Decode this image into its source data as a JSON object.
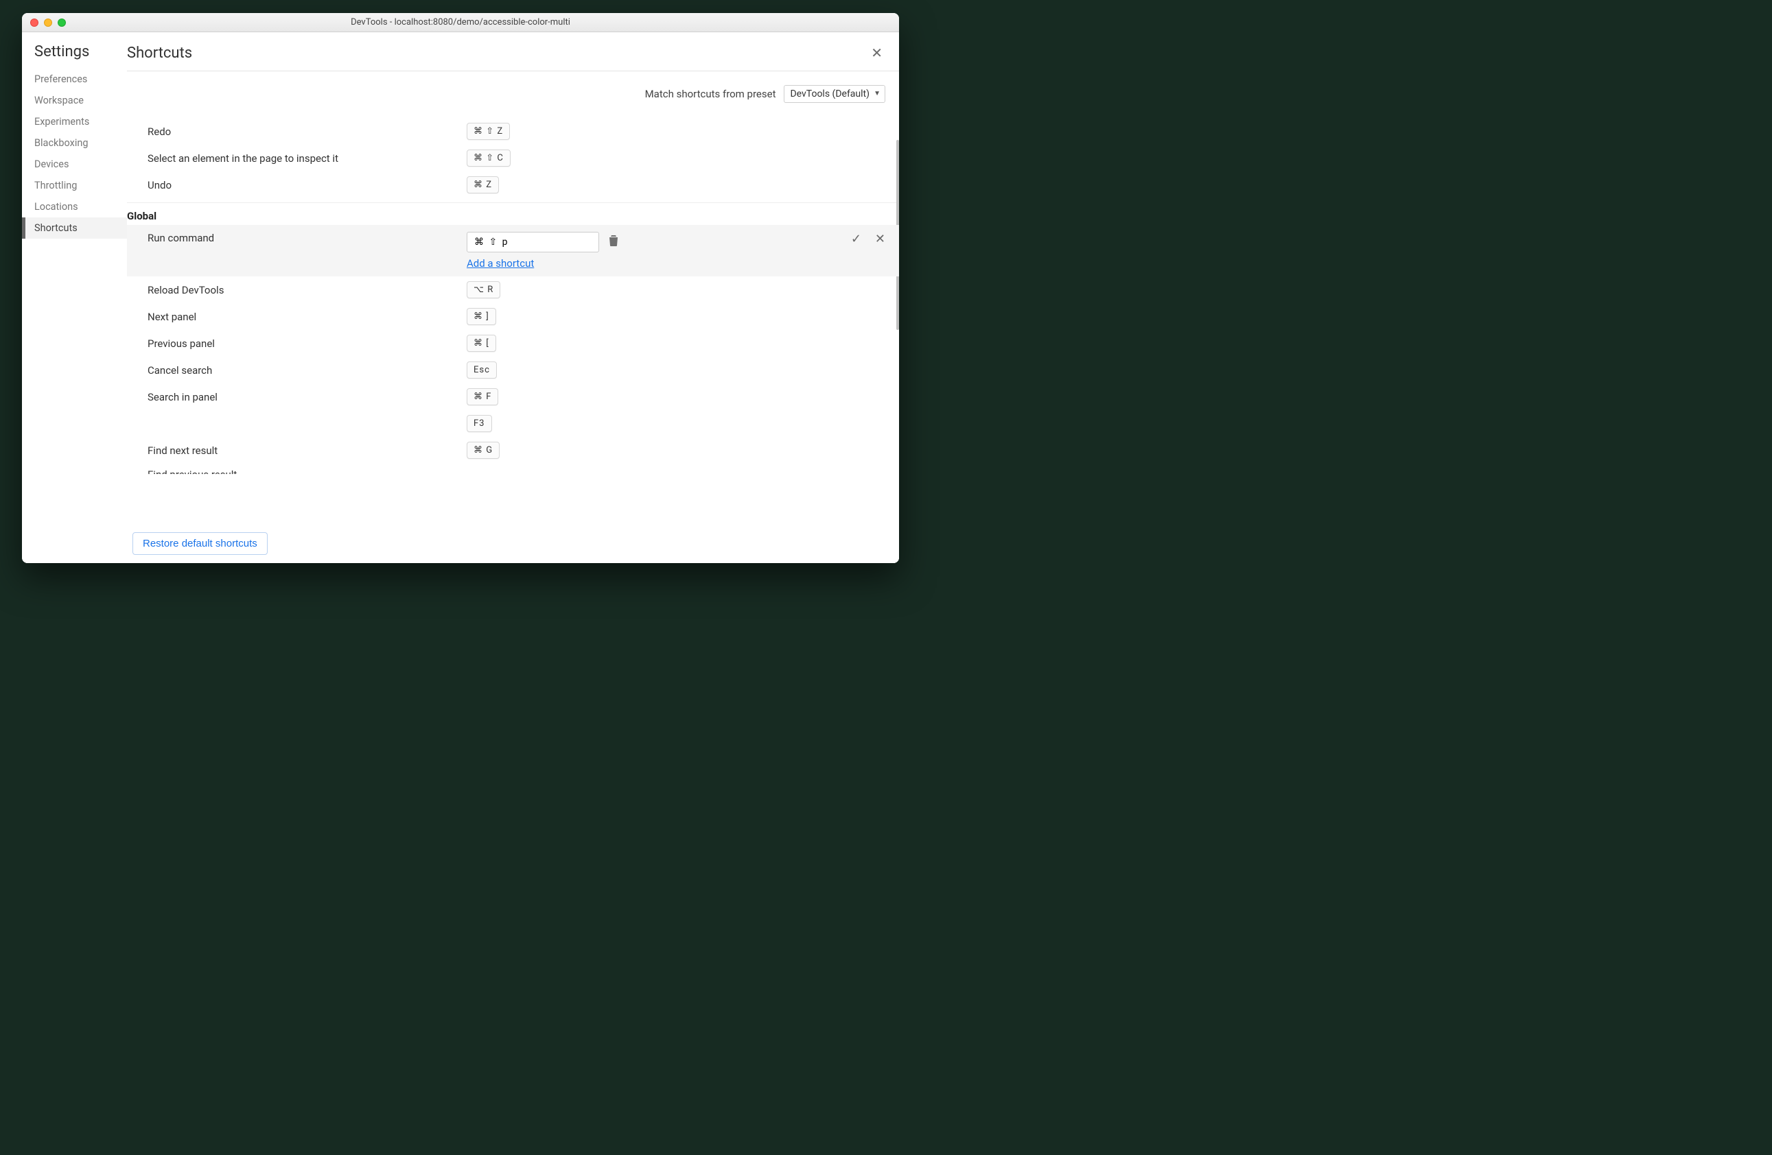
{
  "window_title": "DevTools - localhost:8080/demo/accessible-color-multi",
  "sidebar": {
    "title": "Settings",
    "items": [
      {
        "label": "Preferences"
      },
      {
        "label": "Workspace"
      },
      {
        "label": "Experiments"
      },
      {
        "label": "Blackboxing"
      },
      {
        "label": "Devices"
      },
      {
        "label": "Throttling"
      },
      {
        "label": "Locations"
      },
      {
        "label": "Shortcuts"
      }
    ]
  },
  "page": {
    "title": "Shortcuts",
    "preset_label": "Match shortcuts from preset",
    "preset_value": "DevTools (Default)",
    "restore_label": "Restore default shortcuts"
  },
  "top_rows": [
    {
      "label": "Redo",
      "combo": "⌘ ⇧ Z"
    },
    {
      "label": "Select an element in the page to inspect it",
      "combo": "⌘ ⇧ C"
    },
    {
      "label": "Undo",
      "combo": "⌘  Z"
    }
  ],
  "group": "Global",
  "editing": {
    "label": "Run command",
    "input_value": "⌘ ⇧ p",
    "add_link": "Add a shortcut"
  },
  "bottom_rows": [
    {
      "label": "Reload DevTools",
      "combo": "⌥ R"
    },
    {
      "label": "Next panel",
      "combo": "⌘  ]"
    },
    {
      "label": "Previous panel",
      "combo": "⌘  ["
    },
    {
      "label": "Cancel search",
      "combo": "Esc"
    },
    {
      "label": "Search in panel",
      "combo": "⌘  F"
    },
    {
      "label": "",
      "combo": "F3"
    },
    {
      "label": "Find next result",
      "combo": "⌘  G"
    }
  ],
  "cutoff_label": "Find previous result"
}
